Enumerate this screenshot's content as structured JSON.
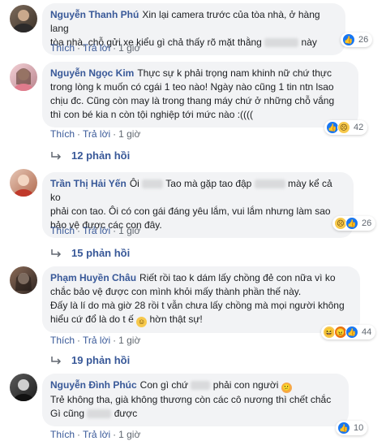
{
  "actions": {
    "like": "Thích",
    "reply": "Trả lời",
    "time": "1 giờ",
    "sep": "·"
  },
  "comments": [
    {
      "author": "Nguyễn Thanh Phú",
      "lines": [
        "Xin lại camera trước của tòa nhà, ở hàng lang",
        "tòa nhà, chỗ gửi xe kiểu gì chả thấy rõ mặt thằng",
        "này"
      ],
      "reaction_count": "26",
      "reactions": [
        "like"
      ]
    },
    {
      "author": "Nguyễn Ngọc Kim",
      "lines": [
        "Thực sự k phải trọng nam khinh nữ chứ thực",
        "trong lòng k muốn có cgái 1 teo nào! Ngày nào cũng 1 tin ntn lsao",
        "chịu đc. Cũng còn may là trong thang máy chứ ở những chỗ vắng",
        "thì con bé kia n còn tội nghiệp tới mức nào :(((("
      ],
      "reaction_count": "42",
      "reactions": [
        "like",
        "sad"
      ],
      "replies": "12 phản hồi"
    },
    {
      "author": "Trần Thị Hải Yến",
      "lines": [
        "Ôi",
        "Tao mà gặp tao đập",
        "mày kể cả ko",
        "phải con tao. Ôi có con gái đáng yêu lắm, vui lắm nhưng làm sao",
        "bảo vệ được các con đây."
      ],
      "reaction_count": "26",
      "reactions": [
        "sad",
        "like"
      ],
      "replies": "15 phản hồi"
    },
    {
      "author": "Phạm Huyền Châu",
      "lines": [
        "Riết rồi tao k dám lấy chồng đẻ con nữa vì ko",
        "chắc bảo vệ được con mình khỏi mấy thành phần thế này.",
        "Đấy là lí do mà giờ 28 rồi t vẫn chưa lấy chồng mà mọi người không",
        "hiểu cứ đổ là do t ế",
        "hờn thật sự!"
      ],
      "reaction_count": "44",
      "reactions": [
        "haha",
        "angry",
        "like"
      ],
      "replies": "19 phản hồi"
    },
    {
      "author": "Nguyễn Đình Phúc",
      "lines": [
        "Con gì chứ",
        "phải con người",
        "Trẻ không tha, già không thương còn các cô nương thì chết chắc",
        "Gì cũng",
        "được"
      ],
      "reaction_count": "10",
      "reactions": [
        "like"
      ]
    }
  ],
  "colors": {
    "link": "#385898",
    "bubble": "#f2f3f5",
    "like": "#1877f2"
  },
  "icons": {
    "like": "thumbs-up-icon",
    "sad": "sad-face-icon",
    "haha": "haha-face-icon",
    "angry": "angry-face-icon",
    "reply_arrow": "reply-arrow-icon",
    "emoji": "smile-emoji-icon"
  }
}
